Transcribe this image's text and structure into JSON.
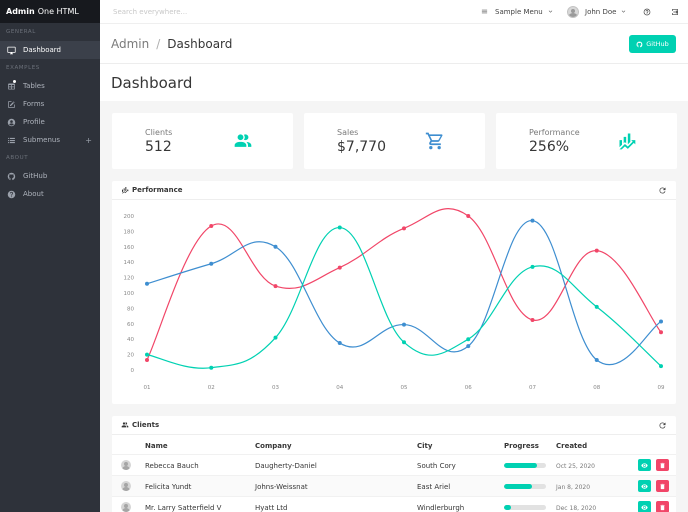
{
  "brand": {
    "bold": "Admin",
    "rest": "One HTML"
  },
  "sidebar": {
    "sections": [
      {
        "label": "General",
        "items": [
          {
            "label": "Dashboard",
            "icon": "desktop-icon",
            "active": true
          }
        ]
      },
      {
        "label": "Examples",
        "items": [
          {
            "label": "Tables",
            "icon": "table-icon"
          },
          {
            "label": "Forms",
            "icon": "form-icon"
          },
          {
            "label": "Profile",
            "icon": "account-circle-icon"
          },
          {
            "label": "Submenus",
            "icon": "list-icon"
          }
        ]
      },
      {
        "label": "About",
        "items": [
          {
            "label": "GitHub",
            "icon": "github-icon"
          },
          {
            "label": "About",
            "icon": "help-circle-icon"
          }
        ]
      }
    ]
  },
  "navbar": {
    "search_placeholder": "Search everywhere...",
    "sample_menu": "Sample Menu",
    "user_name": "John Doe"
  },
  "titlebar": {
    "crumb_prev": "Admin",
    "crumb_current": "Dashboard",
    "github_button": "GitHub"
  },
  "hero": {
    "title": "Dashboard"
  },
  "tiles": [
    {
      "label": "Clients",
      "value": "512",
      "icon": "account-multiple-icon",
      "color": "#00d1b2"
    },
    {
      "label": "Sales",
      "value": "$7,770",
      "icon": "cart-icon",
      "color": "#3e8ed0"
    },
    {
      "label": "Performance",
      "value": "256%",
      "icon": "finance-icon",
      "color": "#00d1b2"
    }
  ],
  "performance_card": {
    "title": "Performance"
  },
  "chart_data": {
    "type": "line",
    "title": "",
    "xlabel": "",
    "ylabel": "",
    "categories": [
      "01",
      "02",
      "03",
      "04",
      "05",
      "06",
      "07",
      "08",
      "09"
    ],
    "ylim": [
      0,
      200
    ],
    "yticks": [
      0,
      20,
      40,
      60,
      80,
      100,
      120,
      140,
      160,
      180,
      200
    ],
    "grid": false,
    "series": [
      {
        "color": "#f14668",
        "values": [
          13,
          187,
          109,
          133,
          184,
          200,
          65,
          155,
          49
        ]
      },
      {
        "color": "#3e8ed0",
        "values": [
          112,
          138,
          160,
          35,
          59,
          31,
          194,
          13,
          63
        ]
      },
      {
        "color": "#00d1b2",
        "values": [
          20,
          3,
          42,
          185,
          36,
          40,
          134,
          82,
          5
        ]
      }
    ]
  },
  "clients_card": {
    "title": "Clients",
    "columns": [
      "Name",
      "Company",
      "City",
      "Progress",
      "Created"
    ],
    "rows": [
      {
        "name": "Rebecca Bauch",
        "company": "Daugherty-Daniel",
        "city": "South Cory",
        "progress": 0.79,
        "created": "Oct 25, 2020"
      },
      {
        "name": "Felicita Yundt",
        "company": "Johns-Weissnat",
        "city": "East Ariel",
        "progress": 0.67,
        "created": "Jan 8, 2020"
      },
      {
        "name": "Mr. Larry Satterfield V",
        "company": "Hyatt Ltd",
        "city": "Windlerburgh",
        "progress": 0.16,
        "created": "Dec 18, 2020"
      }
    ]
  }
}
